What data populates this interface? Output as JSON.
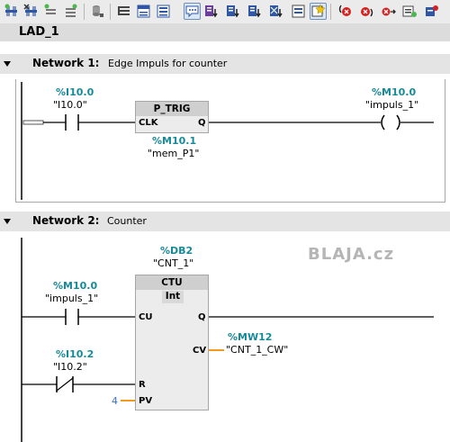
{
  "toolbar": {
    "icons": [
      "insert-network-icon",
      "delete-network-icon",
      "insert-row-icon",
      "append-row-icon",
      "db-icon",
      "show-all-icon",
      "absolute-operands-icon",
      "show-favorites-icon",
      "comments-icon",
      "open-all-networks-icon",
      "close-all-networks-icon",
      "collapse-all-icon",
      "expand-all-icon",
      "show-tags-icon",
      "favorites-icon",
      "go-to-prev-error-icon",
      "go-to-next-error-icon",
      "monitoring-icon",
      "watch-table-icon",
      "breakpoint-icon"
    ]
  },
  "block": {
    "title": "LAD_1"
  },
  "network1": {
    "label": "Network 1:",
    "comment": "Edge Impuls for counter",
    "contact": {
      "address": "%I10.0",
      "symbol": "\"I10.0\""
    },
    "ptrig": {
      "title": "P_TRIG",
      "in_pin": "CLK",
      "out_pin": "Q",
      "mem_address": "%M10.1",
      "mem_symbol": "\"mem_P1\""
    },
    "coil": {
      "address": "%M10.0",
      "symbol": "\"impuls_1\""
    }
  },
  "network2": {
    "label": "Network 2:",
    "comment": "Counter",
    "db": {
      "address": "%DB2",
      "symbol": "\"CNT_1\""
    },
    "ctu": {
      "title": "CTU",
      "type": "Int",
      "pin_cu": "CU",
      "pin_q": "Q",
      "pin_cv": "CV",
      "pin_r": "R",
      "pin_pv": "PV"
    },
    "contact_cu": {
      "address": "%M10.0",
      "symbol": "\"impuls_1\""
    },
    "contact_r": {
      "address": "%I10.2",
      "symbol": "\"I10.2\""
    },
    "cv_out": {
      "address": "%MW12",
      "symbol": "\"CNT_1_CW\""
    },
    "pv_value": "4"
  },
  "watermark": "BLAJA.cz",
  "colors": {
    "address": "#178a9a",
    "wire_param": "#f39a1e",
    "pv_value": "#3a6fd0",
    "header_bg": "#e4e4e4"
  }
}
